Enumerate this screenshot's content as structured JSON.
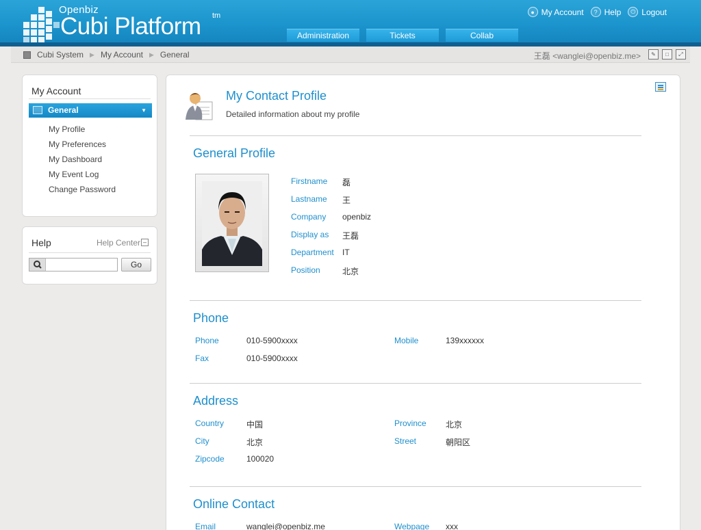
{
  "header": {
    "logo_small": "Openbiz",
    "logo_big": "Cubi Platform",
    "logo_tm": "tm",
    "top_links": [
      {
        "label": "My Account",
        "icon": "person-icon"
      },
      {
        "label": "Help",
        "icon": "question-icon"
      },
      {
        "label": "Logout",
        "icon": "power-icon"
      }
    ],
    "nav_tabs": [
      "Administration",
      "Tickets",
      "Collab"
    ]
  },
  "breadcrumb": {
    "items": [
      "Cubi System",
      "My Account",
      "General"
    ],
    "user": "王磊 <wanglei@openbiz.me>"
  },
  "sidebar": {
    "account_title": "My Account",
    "menu_head": "General",
    "items": [
      "My Profile",
      "My Preferences",
      "My Dashboard",
      "My Event Log",
      "Change Password"
    ],
    "help_title": "Help",
    "help_center": "Help Center",
    "search_placeholder": "",
    "go_label": "Go"
  },
  "main": {
    "title": "My Contact Profile",
    "subtitle": "Detailed information about my profile",
    "general": {
      "title": "General Profile",
      "fields": [
        {
          "label": "Firstname",
          "value": "磊"
        },
        {
          "label": "Lastname",
          "value": "王"
        },
        {
          "label": "Company",
          "value": "openbiz"
        },
        {
          "label": "Display as",
          "value": "王磊"
        },
        {
          "label": "Department",
          "value": "IT"
        },
        {
          "label": "Position",
          "value": "北京"
        }
      ]
    },
    "phone": {
      "title": "Phone",
      "fields": [
        {
          "label": "Phone",
          "value": "010-5900xxxx"
        },
        {
          "label": "Mobile",
          "value": "139xxxxxx"
        },
        {
          "label": "Fax",
          "value": "010-5900xxxx"
        }
      ]
    },
    "address": {
      "title": "Address",
      "fields": [
        {
          "label": "Country",
          "value": "中国"
        },
        {
          "label": "Province",
          "value": "北京"
        },
        {
          "label": "City",
          "value": "北京"
        },
        {
          "label": "Street",
          "value": "朝阳区"
        },
        {
          "label": "Zipcode",
          "value": "100020"
        }
      ]
    },
    "online": {
      "title": "Online Contact",
      "fields": [
        {
          "label": "Email",
          "value": "wanglei@openbiz.me"
        },
        {
          "label": "Webpage",
          "value": "xxx"
        }
      ]
    }
  },
  "colors": {
    "accent": "#1e8fcd",
    "header": "#1b93cc"
  }
}
